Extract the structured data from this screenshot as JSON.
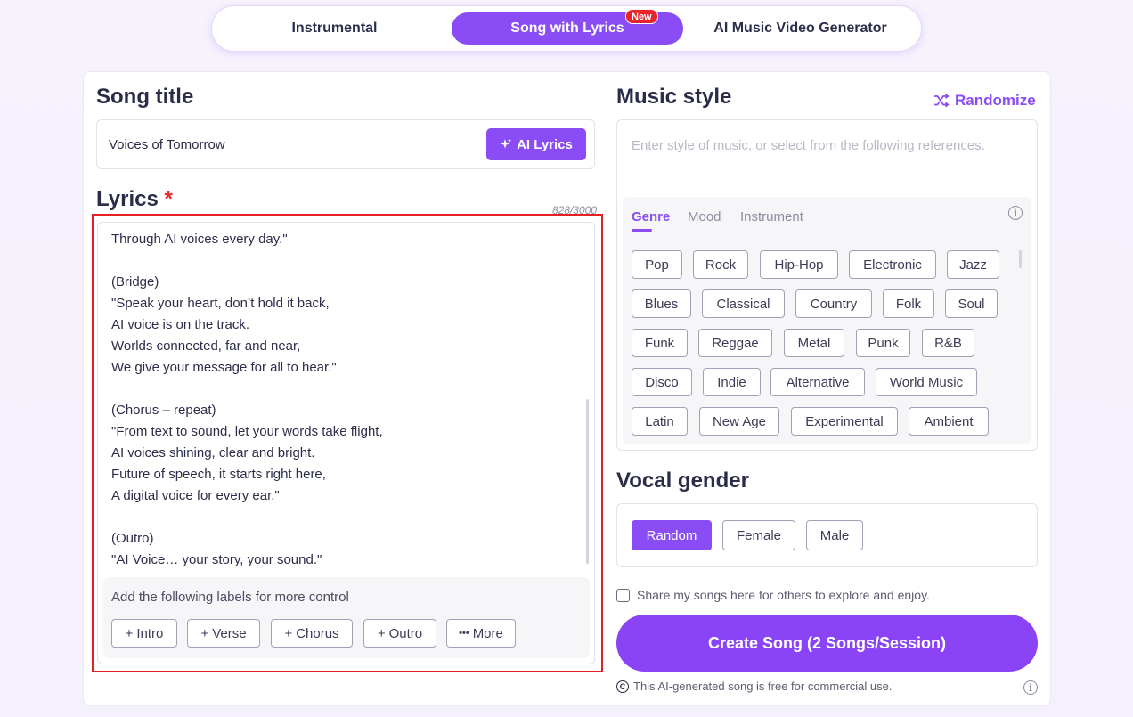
{
  "tabs": [
    {
      "label": "Instrumental",
      "active": false
    },
    {
      "label": "Song with Lyrics",
      "active": true,
      "badge": "New"
    },
    {
      "label": "AI Music Video Generator",
      "active": false
    }
  ],
  "song_title": {
    "heading": "Song title",
    "value": "Voices of Tomorrow",
    "ai_lyrics_label": "AI Lyrics"
  },
  "lyrics": {
    "heading": "Lyrics",
    "required_mark": "*",
    "counter": "828/3000",
    "text": "Through AI voices every day.\"\n\n(Bridge)\n\"Speak your heart, don’t hold it back,\nAI voice is on the track.\nWorlds connected, far and near,\nWe give your message for all to hear.\"\n\n(Chorus – repeat)\n\"From text to sound, let your words take flight,\nAI voices shining, clear and bright.\nFuture of speech, it starts right here,\nA digital voice for every ear.\"\n\n(Outro)\n\"AI Voice… your story, your sound.\"",
    "labels_hint": "Add the following labels for more control",
    "label_buttons": [
      "Intro",
      "Verse",
      "Chorus",
      "Outro",
      "More"
    ]
  },
  "music_style": {
    "heading": "Music style",
    "randomize_label": "Randomize",
    "placeholder": "Enter style of music, or select from the following references.",
    "ref_tabs": [
      "Genre",
      "Mood",
      "Instrument"
    ],
    "genres": [
      [
        "Pop",
        "Rock",
        "Hip-Hop",
        "Electronic",
        "Jazz"
      ],
      [
        "Blues",
        "Classical",
        "Country",
        "Folk",
        "Soul"
      ],
      [
        "Funk",
        "Reggae",
        "Metal",
        "Punk",
        "R&B"
      ],
      [
        "Disco",
        "Indie",
        "Alternative",
        "World Music"
      ],
      [
        "Latin",
        "New Age",
        "Experimental",
        "Ambient"
      ]
    ]
  },
  "vocal_gender": {
    "heading": "Vocal gender",
    "options": [
      "Random",
      "Female",
      "Male"
    ],
    "selected": "Random"
  },
  "share_label": "Share my songs here for others to explore and enjoy.",
  "create_button": "Create Song (2 Songs/Session)",
  "commercial_note": "This AI-generated song is free for commercial use.",
  "colors": {
    "accent": "#8a4cf4",
    "required": "#e8232c",
    "frame": "#e32124"
  },
  "icons": {
    "ai_lyrics": "sparkle-icon",
    "randomize": "shuffle-icon",
    "info": "info-icon",
    "copyright": "copyright-icon",
    "plus": "plus-icon",
    "more": "ellipsis-icon"
  }
}
